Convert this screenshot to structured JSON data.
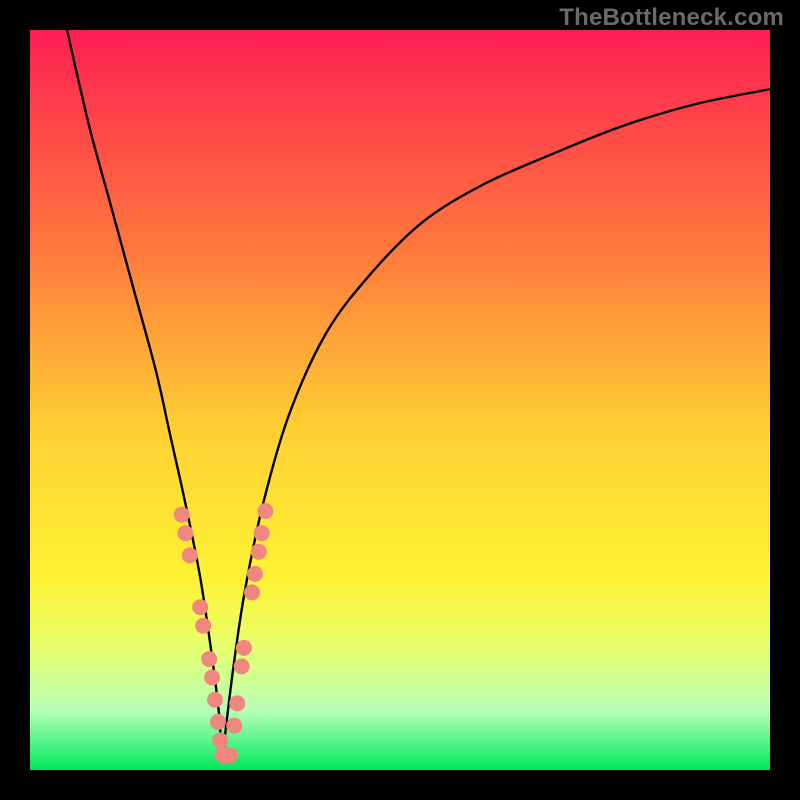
{
  "watermark": "TheBottleneck.com",
  "colors": {
    "gradient_top": "#ff1f53",
    "gradient_mid_upper": "#ff7a3c",
    "gradient_mid": "#ffd233",
    "gradient_mid_lower": "#fff233",
    "gradient_green_haze_top": "#e8ff6b",
    "gradient_green_haze": "#b6ffb6",
    "gradient_bottom": "#00e85a",
    "curve": "#000000",
    "marker": "#f0877e",
    "frame": "#000000"
  },
  "chart_data": {
    "type": "line",
    "title": "",
    "xlabel": "",
    "ylabel": "",
    "x_range": [
      0,
      100
    ],
    "y_range": [
      0,
      100
    ],
    "series": [
      {
        "name": "bottleneck-curve",
        "x": [
          5,
          8,
          11,
          14,
          17,
          19,
          21,
          23,
          24.5,
          25.5,
          26,
          26.5,
          27.5,
          29,
          31.5,
          35,
          40,
          46,
          53,
          61,
          70,
          80,
          90,
          100
        ],
        "y": [
          100,
          87,
          76,
          65,
          54,
          45,
          36,
          26,
          16,
          8,
          2,
          6,
          14,
          24,
          36,
          48,
          59,
          67,
          74,
          79,
          83,
          87,
          90,
          92
        ]
      }
    ],
    "markers": [
      {
        "x": 20.5,
        "y": 34.5
      },
      {
        "x": 21.0,
        "y": 32.0
      },
      {
        "x": 21.6,
        "y": 29.0
      },
      {
        "x": 23.0,
        "y": 22.0
      },
      {
        "x": 23.4,
        "y": 19.5
      },
      {
        "x": 24.2,
        "y": 15.0
      },
      {
        "x": 24.6,
        "y": 12.5
      },
      {
        "x": 25.0,
        "y": 9.5
      },
      {
        "x": 25.4,
        "y": 6.5
      },
      {
        "x": 25.7,
        "y": 4.0
      },
      {
        "x": 26.0,
        "y": 2.0
      },
      {
        "x": 26.4,
        "y": 2.0
      },
      {
        "x": 27.0,
        "y": 2.0
      },
      {
        "x": 27.6,
        "y": 6.0
      },
      {
        "x": 28.0,
        "y": 9.0
      },
      {
        "x": 28.6,
        "y": 14.0
      },
      {
        "x": 28.9,
        "y": 16.5
      },
      {
        "x": 30.0,
        "y": 24.0
      },
      {
        "x": 30.4,
        "y": 26.5
      },
      {
        "x": 30.9,
        "y": 29.5
      },
      {
        "x": 31.3,
        "y": 32.0
      },
      {
        "x": 31.8,
        "y": 35.0
      }
    ],
    "marker_radius_px": 8
  }
}
